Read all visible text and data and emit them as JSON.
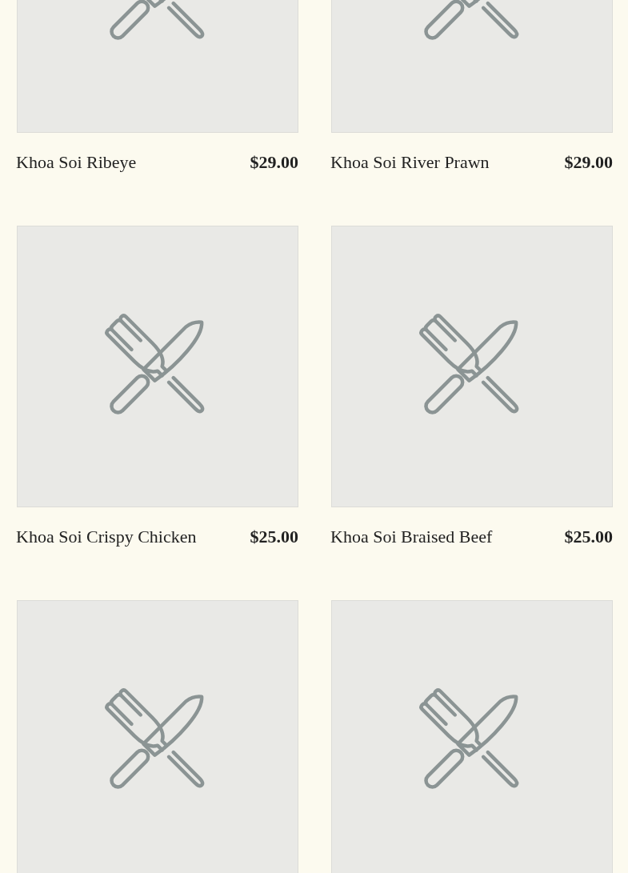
{
  "menu_items": [
    {
      "kind": "dish",
      "name": "Khoa Soi Ribeye",
      "price": "$29.00"
    },
    {
      "kind": "dish",
      "name": "Khoa Soi River Prawn",
      "price": "$29.00"
    },
    {
      "kind": "dish",
      "name": "Khoa Soi Crispy Chicken",
      "price": "$25.00"
    },
    {
      "kind": "dish",
      "name": "Khoa Soi Braised Beef",
      "price": "$25.00"
    },
    {
      "kind": "image_only"
    },
    {
      "kind": "image_only"
    }
  ]
}
